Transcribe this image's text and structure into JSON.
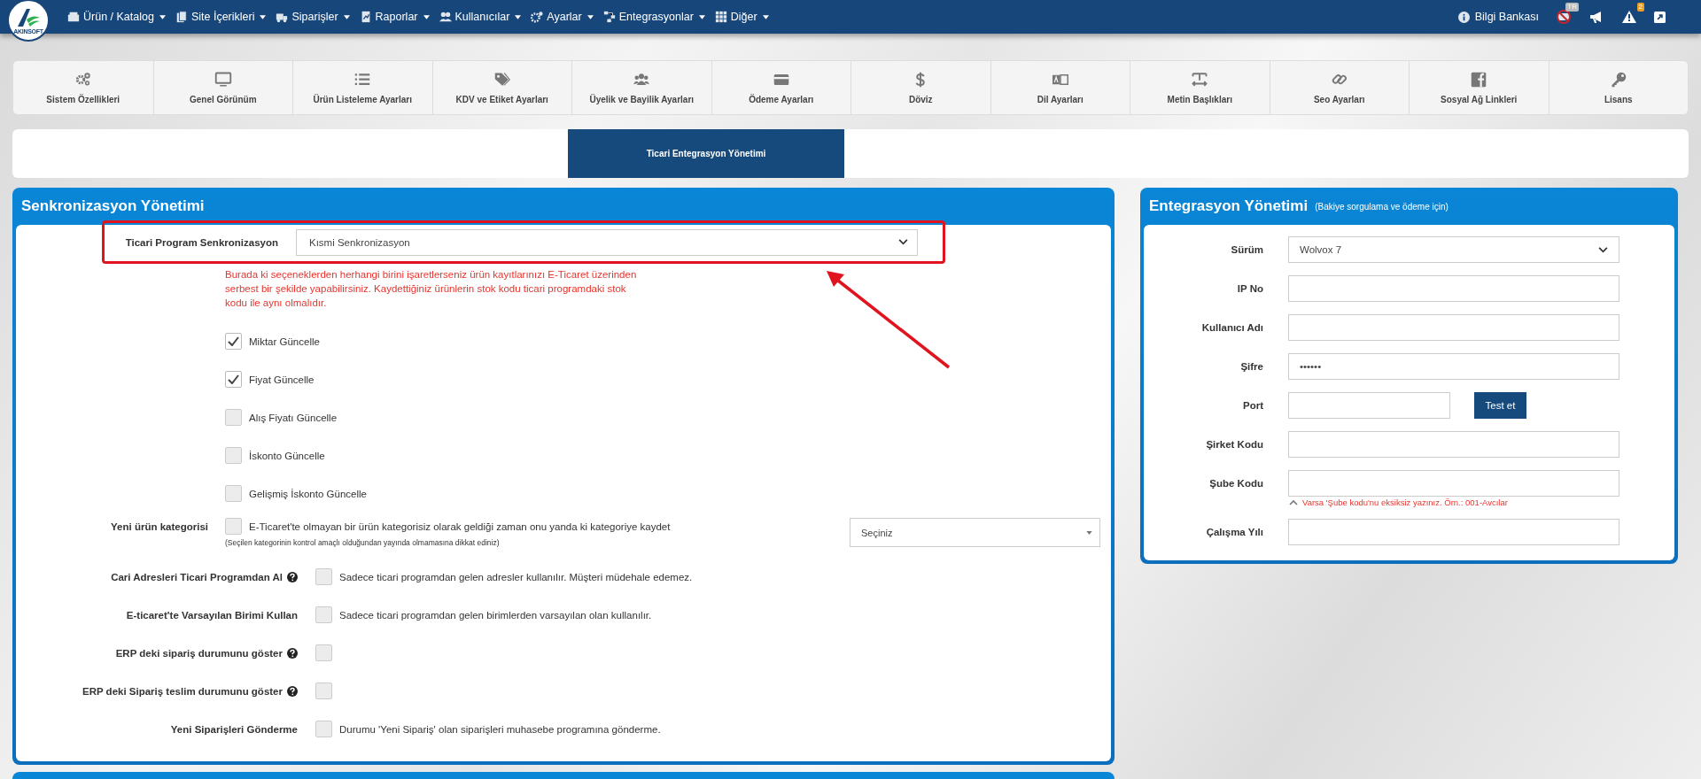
{
  "nav": {
    "logo_text": "AKINSOFT",
    "menu": [
      {
        "label": "Ürün / Katalog"
      },
      {
        "label": "Site İçerikleri"
      },
      {
        "label": "Siparişler"
      },
      {
        "label": "Raporlar"
      },
      {
        "label": "Kullanıcılar"
      },
      {
        "label": "Ayarlar"
      },
      {
        "label": "Entegrasyonlar"
      },
      {
        "label": "Diğer"
      }
    ],
    "help_link": "Bilgi Bankası",
    "language_badge": "TR",
    "alert_badge": "2"
  },
  "settings_tabs": [
    {
      "label": "Sistem Özellikleri"
    },
    {
      "label": "Genel Görünüm"
    },
    {
      "label": "Ürün Listeleme Ayarları"
    },
    {
      "label": "KDV ve Etiket Ayarları"
    },
    {
      "label": "Üyelik ve Bayilik Ayarları"
    },
    {
      "label": "Ödeme Ayarları"
    },
    {
      "label": "Döviz"
    },
    {
      "label": "Dil Ayarları"
    },
    {
      "label": "Metin Başlıkları"
    },
    {
      "label": "Seo Ayarları"
    },
    {
      "label": "Sosyal Ağ Linkleri"
    },
    {
      "label": "Lisans"
    }
  ],
  "sub_tabs": [
    {
      "label": "Ticari Entegrasyon Yönetimi",
      "selected": true
    }
  ],
  "sync_panel": {
    "title": "Senkronizasyon Yönetimi",
    "program_sync": {
      "label": "Ticari Program Senkronizasyon",
      "value": "Kısmi Senkronizasyon"
    },
    "warning": "Burada ki seçeneklerden herhangi birini işaretlerseniz ürün kayıtlarınızı E-Ticaret üzerinden serbest bir şekilde yapabilirsiniz. Kaydettiğiniz ürünlerin stok kodu ticari programdaki stok kodu ile aynı olmalıdır.",
    "options": [
      {
        "label": "Miktar Güncelle",
        "checked": true
      },
      {
        "label": "Fiyat Güncelle",
        "checked": true
      },
      {
        "label": "Alış Fiyatı Güncelle",
        "checked": false
      },
      {
        "label": "İskonto Güncelle",
        "checked": false
      },
      {
        "label": "Gelişmiş İskonto Güncelle",
        "checked": false
      }
    ],
    "new_category": {
      "label": "Yeni ürün kategorisi",
      "checked": false,
      "text": "E-Ticaret'te olmayan bir ürün kategorisiz olarak geldiği zaman onu yanda ki kategoriye kaydet",
      "note": "(Seçilen kategorinin kontrol amaçlı olduğundan yayında olmamasına dikkat ediniz)",
      "select": "Seçiniz"
    },
    "settings": [
      {
        "label": "Cari Adresleri Ticari Programdan Al",
        "help": true,
        "checked": false,
        "text": "Sadece ticari programdan gelen adresler kullanılır. Müşteri müdehale edemez."
      },
      {
        "label": "E-ticaret'te Varsayılan Birimi Kullan",
        "help": false,
        "checked": false,
        "text": "Sadece ticari programdan gelen birimlerden varsayılan olan kullanılır."
      },
      {
        "label": "ERP deki sipariş durumunu göster",
        "help": true,
        "checked": false
      },
      {
        "label": "ERP deki Sipariş teslim durumunu göster",
        "help": true,
        "checked": false
      },
      {
        "label": "Yeni Siparişleri Gönderme",
        "help": false,
        "checked": false,
        "text": "Durumu 'Yeni Sipariş' olan siparişleri muhasebe programına gönderme."
      }
    ]
  },
  "integration_panel": {
    "title": "Entegrasyon Yönetimi",
    "subtitle": "(Bakiye sorgulama ve ödeme için)",
    "fields": [
      {
        "label": "Sürüm",
        "kind": "select",
        "value": "Wolvox 7"
      },
      {
        "label": "IP No",
        "kind": "input"
      },
      {
        "label": "Kullanıcı Adı",
        "kind": "input"
      },
      {
        "label": "Şifre",
        "kind": "password",
        "value": "••••••"
      },
      {
        "label": "Port",
        "kind": "input_button",
        "button": "Test et"
      },
      {
        "label": "Şirket Kodu",
        "kind": "input"
      },
      {
        "label": "Şube Kodu",
        "kind": "input",
        "hint": "Varsa 'Şube kodu'nu eksiksiz yazınız. Örn.: 001-Avcılar"
      },
      {
        "label": "Çalışma Yılı",
        "kind": "input"
      }
    ]
  }
}
